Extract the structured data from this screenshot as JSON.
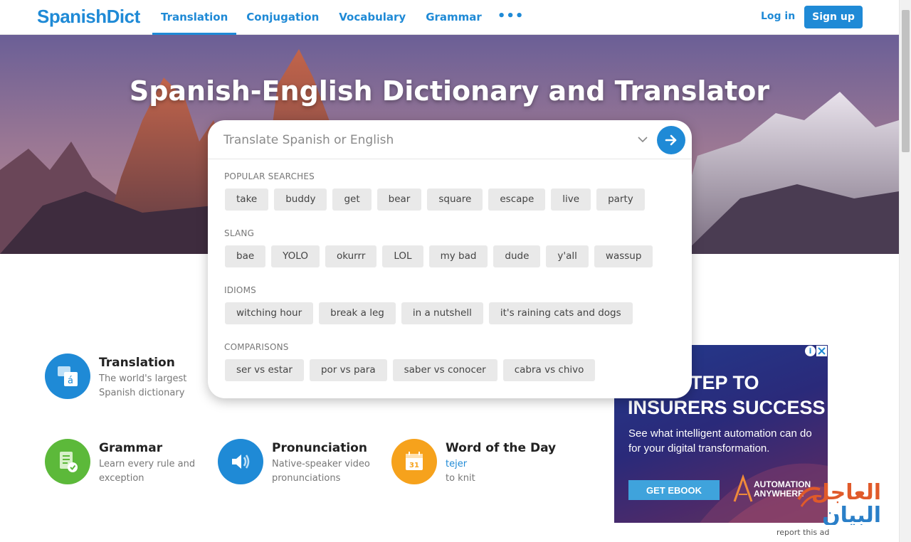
{
  "header": {
    "logo": "SpanishDict",
    "nav": [
      "Translation",
      "Conjugation",
      "Vocabulary",
      "Grammar"
    ],
    "more": "•••",
    "login": "Log in",
    "signup": "Sign up"
  },
  "hero": {
    "title": "Spanish-English Dictionary and Translator"
  },
  "search": {
    "placeholder": "Translate Spanish or English",
    "sections": [
      {
        "label": "POPULAR SEARCHES",
        "chips": [
          "take",
          "buddy",
          "get",
          "bear",
          "square",
          "escape",
          "live",
          "party"
        ]
      },
      {
        "label": "SLANG",
        "chips": [
          "bae",
          "YOLO",
          "okurrr",
          "LOL",
          "my bad",
          "dude",
          "y'all",
          "wassup"
        ]
      },
      {
        "label": "IDIOMS",
        "chips": [
          "witching hour",
          "break a leg",
          "in a nutshell",
          "it's raining cats and dogs"
        ]
      },
      {
        "label": "COMPARISONS",
        "chips": [
          "ser vs estar",
          "por vs para",
          "saber vs conocer",
          "cabra vs chivo"
        ]
      }
    ]
  },
  "features": {
    "translation": {
      "title": "Translation",
      "desc": "The world's largest Spanish dictionary"
    },
    "grammar": {
      "title": "Grammar",
      "desc": "Learn every rule and exception"
    },
    "pronunciation": {
      "title": "Pronunciation",
      "desc": "Native-speaker video pronunciations"
    },
    "wotd": {
      "title": "Word of the Day",
      "word": "tejer",
      "meaning": "to knit",
      "calendar_day": "31"
    }
  },
  "ad": {
    "headline_1": "ICAL STEP TO",
    "headline_2": "INSURERS SUCCESS",
    "sub": "See what intelligent automation can do for your digital transformation.",
    "cta": "GET EBOOK",
    "brand_1": "AUTOMATION",
    "brand_2": "ANYWHERE",
    "report": "report this ad",
    "info": "i"
  },
  "watermark": {
    "line_1": "العاجل",
    "line_2": "البيان"
  },
  "colors": {
    "brand": "#1f8ad6",
    "translation": "#1f8ad6",
    "grammar": "#5cb93a",
    "pronunciation": "#1f8ad6",
    "wotd": "#f6a21c"
  }
}
